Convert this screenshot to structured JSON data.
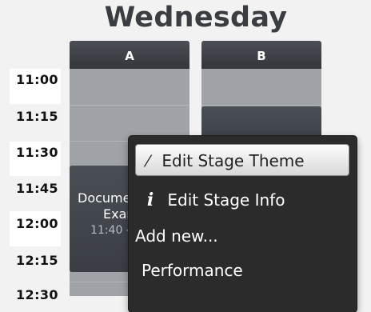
{
  "title": "Wednesday",
  "times": [
    "11:00",
    "11:15",
    "11:30",
    "11:45",
    "12:00",
    "12:15",
    "12:30"
  ],
  "stages": [
    {
      "label": "A"
    },
    {
      "label": "B"
    }
  ],
  "event": {
    "title_line1": "Docume",
    "title_line2": "Exar",
    "time": "11:40 -"
  },
  "context_menu": {
    "edit_theme": "Edit Stage Theme",
    "edit_info": "Edit Stage Info",
    "add_new": "Add new...",
    "performance": "Performance",
    "icons": {
      "theme": "paintbrush-icon",
      "info": "info-icon"
    }
  },
  "colors": {
    "header": "#3a3d42",
    "column": "#9fa2a6",
    "event": "#44484e",
    "menu": "#2b2b2b"
  }
}
